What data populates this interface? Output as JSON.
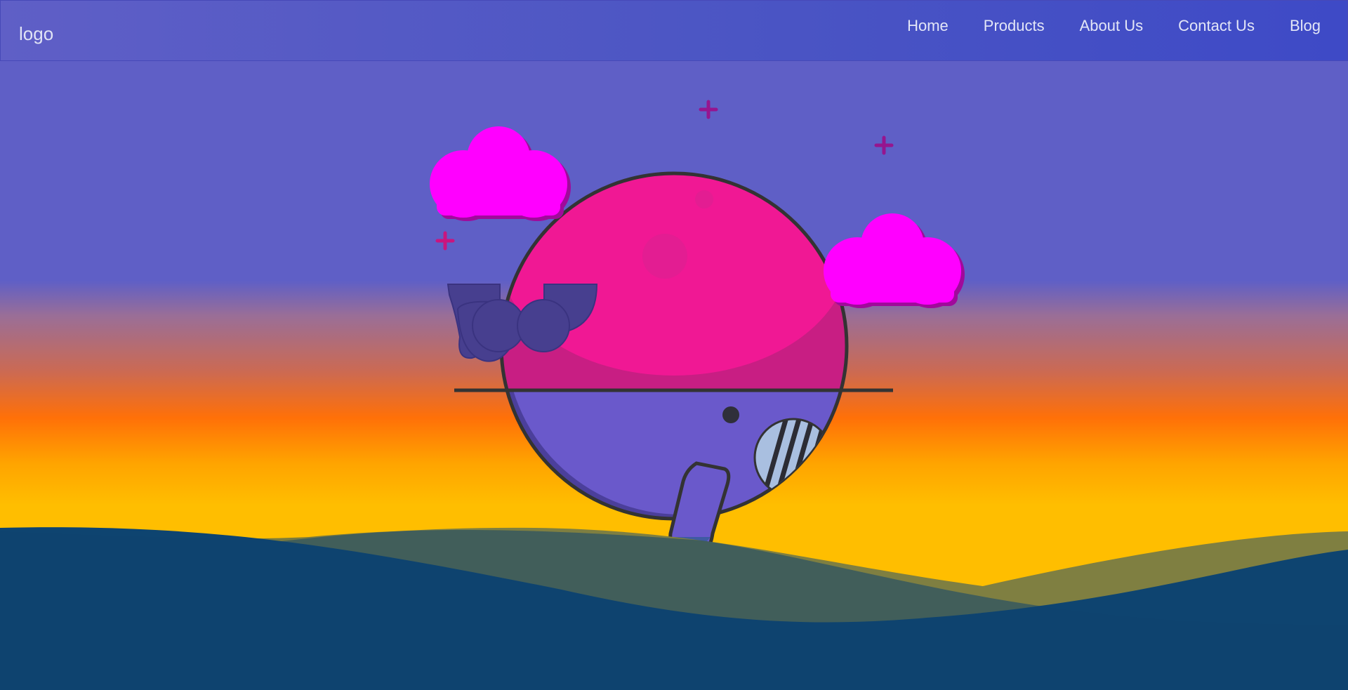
{
  "navbar": {
    "logo": "logo",
    "links": [
      "Home",
      "Products",
      "About Us",
      "Contact Us",
      "Blog"
    ]
  },
  "colors": {
    "sky_top": "#5f5fc6",
    "sunset_orange": "#ff7008",
    "sunset_yellow": "#ffbe00",
    "cloud": "#ff00ff",
    "planet_top": "#f01894",
    "planet_bottom": "#6a59cb",
    "sea_dark": "#0e4470",
    "wave_olive": "#7f7f41"
  },
  "illustration": {
    "sparkle_icon": "plus-sparkle-icon",
    "cloud_icon": "cloud-icon",
    "planet_icon": "planet-with-tentacle-icon"
  }
}
